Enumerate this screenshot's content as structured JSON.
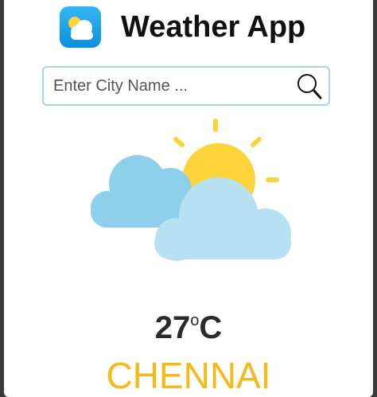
{
  "header": {
    "title": "Weather App",
    "logo_icon": "cloud-sun-icon"
  },
  "search": {
    "placeholder": "Enter City Name ...",
    "value": "",
    "button_icon": "magnifier-icon"
  },
  "weather": {
    "icon": "partly-cloudy-icon",
    "temperature_value": "27",
    "temperature_degree": "o",
    "temperature_unit": "C",
    "city": "CHENNAI"
  },
  "colors": {
    "accent_city": "#f6b91a",
    "search_border": "#a9d3ea",
    "cloud_front": "#b5e1f3",
    "cloud_back": "#8ed0eb",
    "sun": "#fdd33a",
    "logo_bg": "#1aa0e6"
  }
}
